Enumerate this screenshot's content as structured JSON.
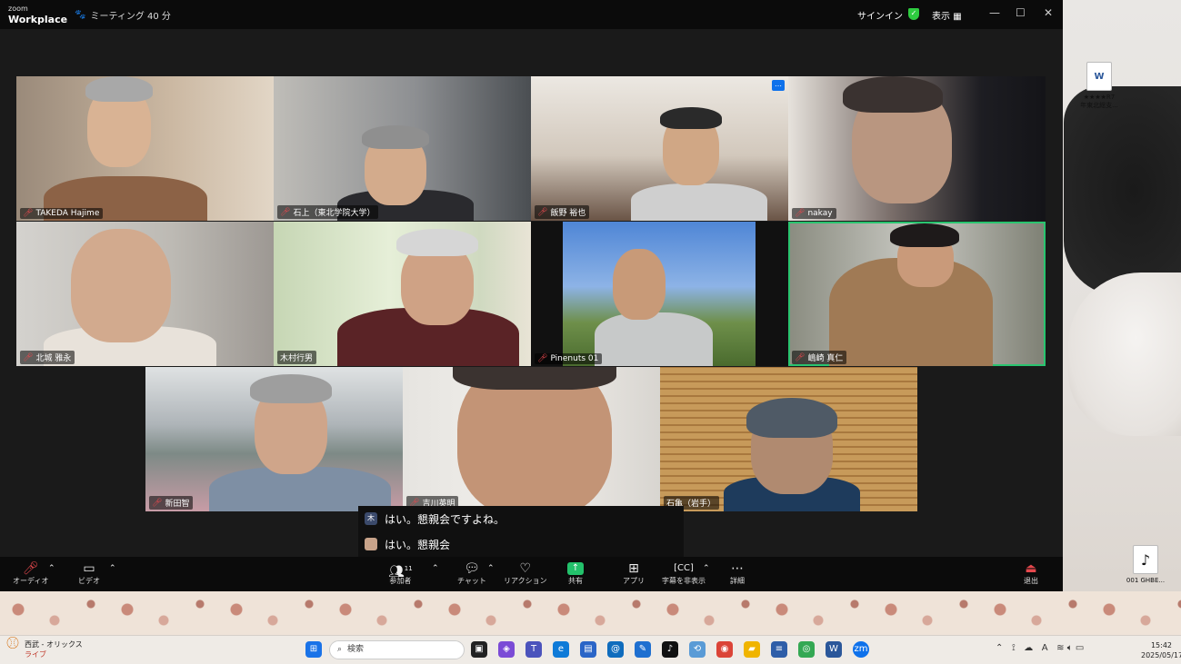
{
  "window": {
    "logo_top": "zoom",
    "logo_bottom": "Workplace",
    "meeting_timer": "ミーティング 40 分",
    "signin": "サインイン",
    "view": "表示",
    "minimize": "—",
    "maximize": "☐",
    "close": "✕"
  },
  "participants": [
    {
      "name": "TAKEDA Hajime",
      "muted": true
    },
    {
      "name": "石上（東北学院大学）",
      "muted": true
    },
    {
      "name": "飯野 裕也",
      "muted": true
    },
    {
      "name": "nakay",
      "muted": true
    },
    {
      "name": "北城 雅永",
      "muted": true
    },
    {
      "name": "木村行男",
      "muted": false
    },
    {
      "name": "Pinenuts 01",
      "muted": true
    },
    {
      "name": "嶋崎 真仁",
      "muted": true
    },
    {
      "name": "新田智",
      "muted": true
    },
    {
      "name": "吉川英明",
      "muted": true
    },
    {
      "name": "石亀（岩手）",
      "muted": false
    }
  ],
  "more_options": "…",
  "captions": [
    {
      "avatar": "木",
      "text": "はい。懇親会ですよね。"
    },
    {
      "avatar": "",
      "text": "はい。懇親会"
    }
  ],
  "toolbar": {
    "audio": "オーディオ",
    "video": "ビデオ",
    "participants": "参加者",
    "participant_count": "11",
    "chat": "チャット",
    "reactions": "リアクション",
    "share": "共有",
    "apps": "アプリ",
    "captions": "字幕を非表示",
    "more": "詳細",
    "leave": "退出"
  },
  "desktop": {
    "file_icon_label_1": "★★★★R7",
    "file_icon_label_2": "年東北総支...",
    "music_icon_label": "001 GHBE..."
  },
  "taskbar": {
    "weather_line1": "西武 - オリックス",
    "weather_line2": "ライブ",
    "search_placeholder": "検索",
    "time": "15:42",
    "date": "2025/05/17"
  }
}
